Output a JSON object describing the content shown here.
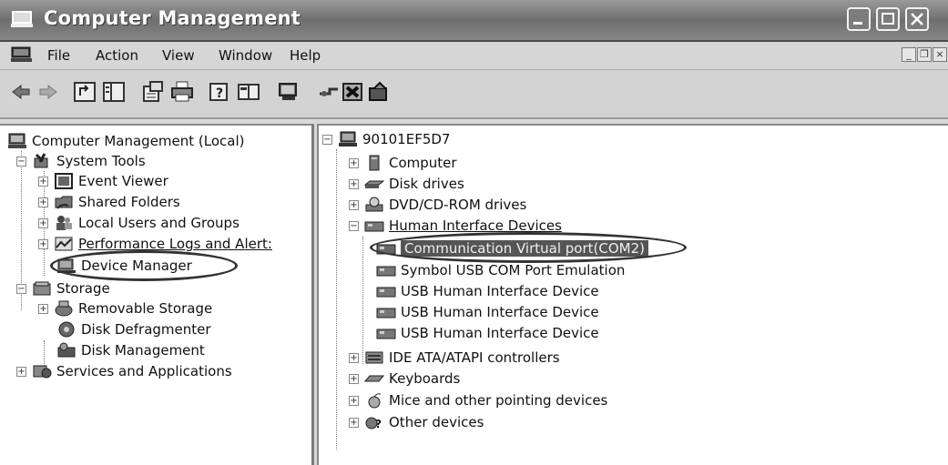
{
  "window": {
    "title": "Computer Management"
  },
  "menu": {
    "items": [
      "File",
      "Action",
      "View",
      "Window",
      "Help"
    ]
  },
  "toolbar": {
    "icons": [
      "back-icon",
      "forward-icon",
      "up-icon",
      "show-hide-tree-icon",
      "properties-icon",
      "print-icon",
      "help-icon",
      "console-icon",
      "scan-hardware-icon",
      "uninstall-icon",
      "disable-icon",
      "update-driver-icon"
    ]
  },
  "left_tree": {
    "root": "Computer Management (Local)",
    "system_tools": "System Tools",
    "event_viewer": "Event Viewer",
    "shared_folders": "Shared Folders",
    "local_users": "Local Users and Groups",
    "perf_logs": "Performance Logs and Alert:",
    "device_manager": "Device Manager",
    "storage": "Storage",
    "removable_storage": "Removable Storage",
    "disk_defrag": "Disk Defragmenter",
    "disk_mgmt": "Disk Management",
    "services_apps": "Services and Applications"
  },
  "right_tree": {
    "root": "90101EF5D7",
    "computer": "Computer",
    "disk_drives": "Disk drives",
    "dvd": "DVD/CD-ROM drives",
    "hid": "Human Interface Devices",
    "hid_children": [
      "Communication Virtual port(COM2)",
      "Symbol USB COM Port Emulation",
      "USB Human Interface Device",
      "USB Human Interface Device",
      "USB Human Interface Device"
    ],
    "ide": "IDE ATA/ATAPI controllers",
    "keyboards": "Keyboards",
    "mice": "Mice and other pointing devices",
    "other": "Other devices"
  }
}
